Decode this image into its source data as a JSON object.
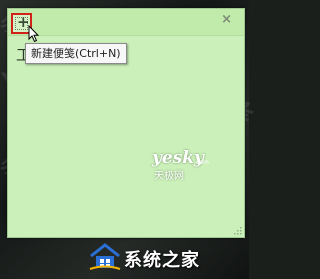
{
  "note": {
    "add_button_label": "+",
    "close_label": "×",
    "content": "工",
    "background_color": "#cbf0b9"
  },
  "tooltip": {
    "text": "新建便笺(Ctrl+N)"
  },
  "watermark": {
    "brand": "yesky",
    "sub": "天极网",
    "tag": "com"
  },
  "footer_logo": {
    "text": "系统之家"
  },
  "icons": {
    "add": "plus-icon",
    "close": "close-icon",
    "cursor": "mouse-pointer-icon",
    "grip": "resize-grip-icon",
    "logo": "house-logo-icon"
  },
  "colors": {
    "highlight": "#d2231b",
    "note_header": "#c1ebab",
    "tooltip_bg": "#f7f7f7"
  }
}
